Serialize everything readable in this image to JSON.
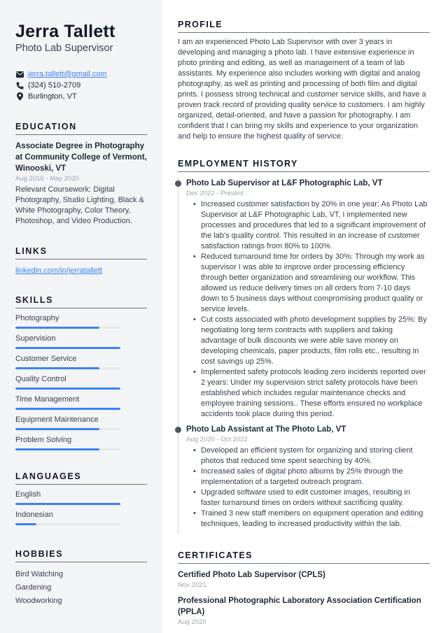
{
  "header": {
    "name": "Jerra Tallett",
    "title": "Photo Lab Supervisor",
    "contacts": {
      "email": "jerra.tallett@gmail.com",
      "phone": "(324) 510-2709",
      "location": "Burlington, VT"
    }
  },
  "colors": {
    "accent": "#3b82f6",
    "sidebar_bg": "#f3f4f6",
    "text": "#1f2937"
  },
  "education": {
    "heading": "EDUCATION",
    "degree": "Associate Degree in Photography at Community College of Vermont, Winooski, VT",
    "dates": "Aug 2016 - May 2020",
    "description": "Relevant Coursework: Digital Photography, Studio Lighting, Black & White Photography, Color Theory, Photoshop, and Video Production."
  },
  "links": {
    "heading": "LINKS",
    "items": [
      {
        "label": "linkedin.com/in/jerratallett"
      }
    ]
  },
  "skills": {
    "heading": "SKILLS",
    "items": [
      {
        "label": "Photography",
        "level": 0.8
      },
      {
        "label": "Supervision",
        "level": 1.0
      },
      {
        "label": "Customer Service",
        "level": 0.8
      },
      {
        "label": "Quality Control",
        "level": 1.0
      },
      {
        "label": "Time Management",
        "level": 1.0
      },
      {
        "label": "Equipment Maintenance",
        "level": 0.8
      },
      {
        "label": "Problem Solving",
        "level": 0.8
      }
    ]
  },
  "languages": {
    "heading": "LANGUAGES",
    "items": [
      {
        "label": "English",
        "level": 1.0
      },
      {
        "label": "Indonesian",
        "level": 0.2
      }
    ]
  },
  "hobbies": {
    "heading": "HOBBIES",
    "items": [
      "Bird Watching",
      "Gardening",
      "Woodworking"
    ]
  },
  "profile": {
    "heading": "PROFILE",
    "text": "I am an experienced Photo Lab Supervisor with over 3 years in developing and managing a photo lab. I have extensive experience in photo printing and editing, as well as management of a team of lab assistants. My experience also includes working with digital and analog photography, as well as printing and processing of both film and digital prints. I possess strong technical and customer service skills, and have a proven track record of providing quality service to customers. I am highly organized, detail-oriented, and have a passion for photography. I am confident that I can bring my skills and experience to your organization and help to ensure the highest quality of service."
  },
  "employment": {
    "heading": "EMPLOYMENT HISTORY",
    "jobs": [
      {
        "title": "Photo Lab Supervisor at L&F Photographic Lab, VT",
        "dates": "Dec 2022 - Present",
        "bullets": [
          "Increased customer satisfaction by 20% in one year: As Photo Lab Supervisor at L&F Photographic Lab, VT, I implemented new processes and procedures that led to a significant improvement of the lab's quality control. This resulted in an increase of customer satisfaction ratings from 80% to 100%.",
          "Reduced turnaround time for orders by 30%: Through my work as supervisor I was able to improve order processing efficiency through better organization and streamlining our workflow. This allowed us reduce delivery times on all orders from 7-10 days down to 5 business days without compromising product quality or service levels.",
          "Cut costs associated with photo development supplies by 25%: By negotiating long term contracts with suppliers and taking advantage of bulk discounts we were able save money on developing chemicals, paper products, film rolls etc., resulting in cost savings up 25%.",
          "Implemented safety protocols leading zero incidents reported over 2 years: Under my supervision strict safety protocols have been established which includes regular maintenance checks and employee training sessions.. These efforts ensured no workplace accidents took place during this period."
        ]
      },
      {
        "title": "Photo Lab Assistant at The Photo Lab, VT",
        "dates": "Aug 2020 - Oct 2022",
        "bullets": [
          "Developed an efficient system for organizing and storing client photos that reduced time spent searching by 40%.",
          "Increased sales of digital photo albums by 25% through the implementation of a targeted outreach program.",
          "Upgraded software used to edit customer images, resulting in faster turnaround times on orders without sacrificing quality.",
          "Trained 3 new staff members on equipment operation and editing techniques, leading to increased productivity within the lab."
        ]
      }
    ]
  },
  "certificates": {
    "heading": "CERTIFICATES",
    "items": [
      {
        "title": "Certified Photo Lab Supervisor (CPLS)",
        "date": "Nov 2021"
      },
      {
        "title": "Professional Photographic Laboratory Association Certification (PPLA)",
        "date": "Aug 2020"
      }
    ]
  }
}
